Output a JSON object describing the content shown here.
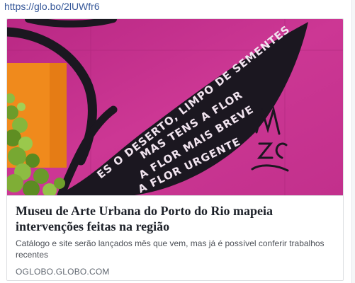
{
  "post": {
    "link_text": "https://glo.bo/2lUWfr6"
  },
  "link_card": {
    "image": {
      "mural_text_lines": [
        "ES O DESERTO, LIMPO DE SEMENTES",
        "MAS TENS A FLOR",
        "A FLOR MAIS BREVE",
        "A FLOR URGENTE"
      ],
      "signature": "MZC",
      "colors": {
        "wall_magenta": "#c52f8e",
        "wall_pink_light": "#d84aa3",
        "leaf_black": "#1b1720",
        "orange_panel": "#f08a1c",
        "foliage_green": "#7fae36"
      }
    },
    "title": "Museu de Arte Urbana do Porto do Rio mapeia intervenções feitas na região",
    "description": "Catálogo e site serão lançados mês que vem, mas já é possível conferir trabalhos recentes",
    "domain": "OGLOBO.GLOBO.COM"
  }
}
